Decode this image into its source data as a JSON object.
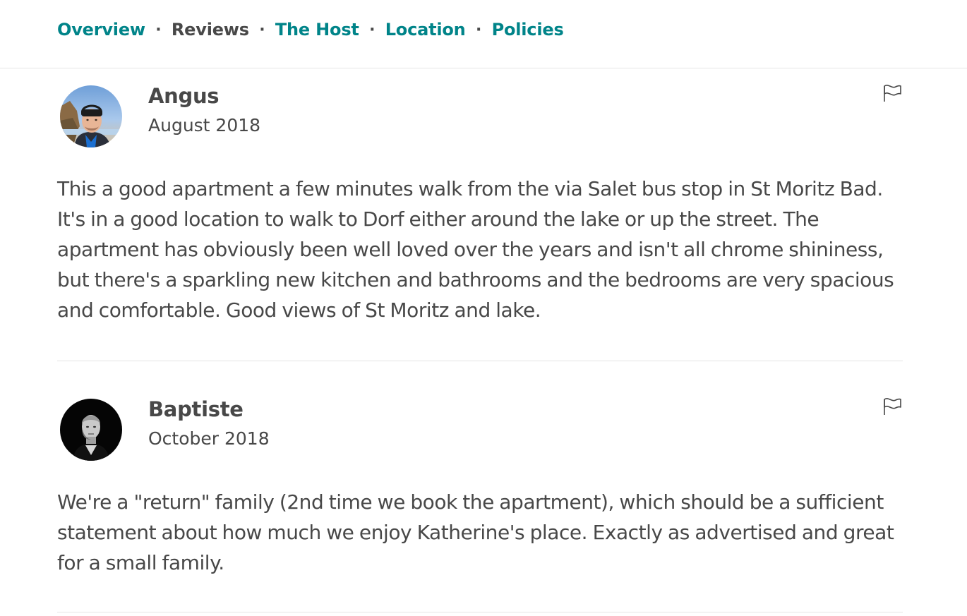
{
  "nav": {
    "items": [
      {
        "label": "Overview",
        "active": false
      },
      {
        "label": "Reviews",
        "active": true
      },
      {
        "label": "The Host",
        "active": false
      },
      {
        "label": "Location",
        "active": false
      },
      {
        "label": "Policies",
        "active": false
      }
    ],
    "separator": "·"
  },
  "reviews": [
    {
      "name": "Angus",
      "date": "August 2018",
      "text": "This a good apartment a few minutes walk from the via Salet bus stop in St Moritz Bad. It's in a good location to walk to Dorf either around the lake or up the street. The apartment has obviously been well loved over the years and isn't all chrome shininess, but there's a sparkling new kitchen and bathrooms and the bedrooms are very spacious and comfortable. Good views of St Moritz and lake.",
      "flag_icon": "flag-icon"
    },
    {
      "name": "Baptiste",
      "date": "October 2018",
      "text": "We're a \"return\" family (2nd time we book the apartment), which should be a sufficient statement about how much we enjoy Katherine's place. Exactly as advertised and great for a small family.",
      "flag_icon": "flag-icon"
    }
  ],
  "colors": {
    "accent": "#008489",
    "text": "#484848",
    "divider": "#e4e4e4"
  }
}
